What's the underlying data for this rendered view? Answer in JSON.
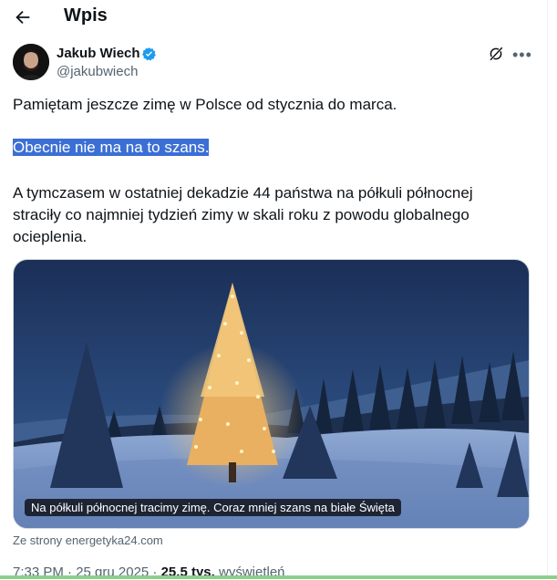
{
  "header": {
    "title": "Wpis"
  },
  "post": {
    "author_name": "Jakub Wiech",
    "handle": "@jakubwiech",
    "paragraph1": "Pamiętam jeszcze zimę w Polsce od stycznia do marca.",
    "paragraph2": "Obecnie nie ma na to szans.",
    "paragraph3": "A tymczasem w ostatniej dekadzie 44 państwa na półkuli północnej straciły co najmniej tydzień zimy w skali roku z powodu globalnego ocieplenia.",
    "card_caption": "Na półkuli północnej tracimy zimę. Coraz mniej szans na białe Święta",
    "source": "Ze strony energetyka24.com",
    "time": "7:33 PM · 25 gru 2025 · ",
    "views_count": "25,5 tys.",
    "views_label": " wyświetleń"
  },
  "icons": [
    "back-arrow-icon",
    "verified-badge-icon",
    "grok-icon",
    "more-icon"
  ],
  "colors": {
    "accent": "#1d9bf0",
    "highlight": "#3b6fd4",
    "secondary_text": "#536471"
  }
}
